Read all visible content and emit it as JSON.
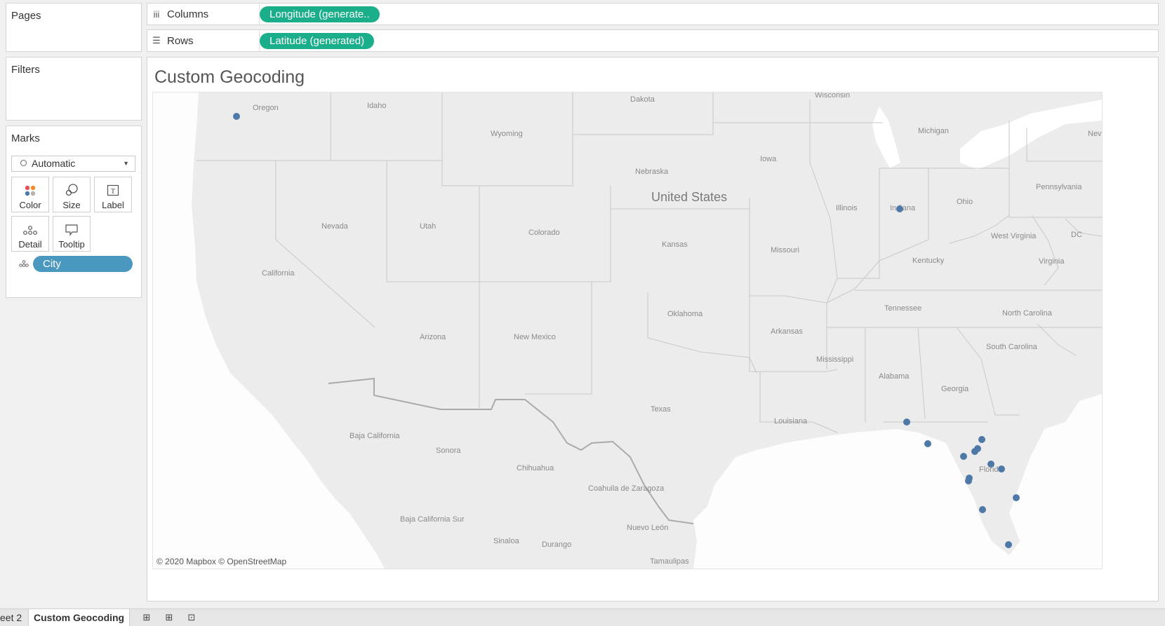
{
  "cards": {
    "pages_title": "Pages",
    "filters_title": "Filters",
    "marks_title": "Marks"
  },
  "shelves": {
    "columns": {
      "label": "Columns",
      "icon": "columns-icon",
      "pill": "Longitude (generate.."
    },
    "rows": {
      "label": "Rows",
      "icon": "rows-icon",
      "pill": "Latitude (generated)"
    }
  },
  "marks": {
    "type": "Automatic",
    "buttons": [
      {
        "name": "color",
        "label": "Color",
        "icon": "color-icon"
      },
      {
        "name": "size",
        "label": "Size",
        "icon": "size-icon"
      },
      {
        "name": "label",
        "label": "Label",
        "icon": "label-icon"
      },
      {
        "name": "detail",
        "label": "Detail",
        "icon": "detail-icon"
      },
      {
        "name": "tooltip",
        "label": "Tooltip",
        "icon": "tooltip-icon"
      }
    ],
    "field": "City"
  },
  "view": {
    "title": "Custom Geocoding",
    "map_copyright": "© 2020 Mapbox © OpenStreetMap",
    "country_label": "United States",
    "point_color": "#4e79a7",
    "labels": [
      "Oregon",
      "Idaho",
      "Wyoming",
      "Dakota",
      "Wisconsin",
      "Michigan",
      "Nev",
      "Iowa",
      "Nebraska",
      "Pennsylvania",
      "Ohio",
      "Illinois",
      "Indiana",
      "Nevada",
      "Utah",
      "Colorado",
      "Kansas",
      "Missouri",
      "West Virginia",
      "DC",
      "Virginia",
      "Kentucky",
      "California",
      "Tennessee",
      "North Carolina",
      "Oklahoma",
      "Arkansas",
      "Arizona",
      "New Mexico",
      "South Carolina",
      "Mississippi",
      "Alabama",
      "Georgia",
      "Texas",
      "Louisiana",
      "Baja California",
      "Sonora",
      "Florida",
      "Chihuahua",
      "Coahuila de Zaragoza",
      "Baja California Sur",
      "Nuevo León",
      "Sinaloa",
      "Durango",
      "Tamaulipas"
    ]
  },
  "tabs": {
    "sheet_partial": "eet 2",
    "active": "Custom Geocoding",
    "new_sheet_icon": "new-worksheet-icon",
    "new_dashboard_icon": "new-dashboard-icon",
    "new_story_icon": "new-story-icon"
  }
}
